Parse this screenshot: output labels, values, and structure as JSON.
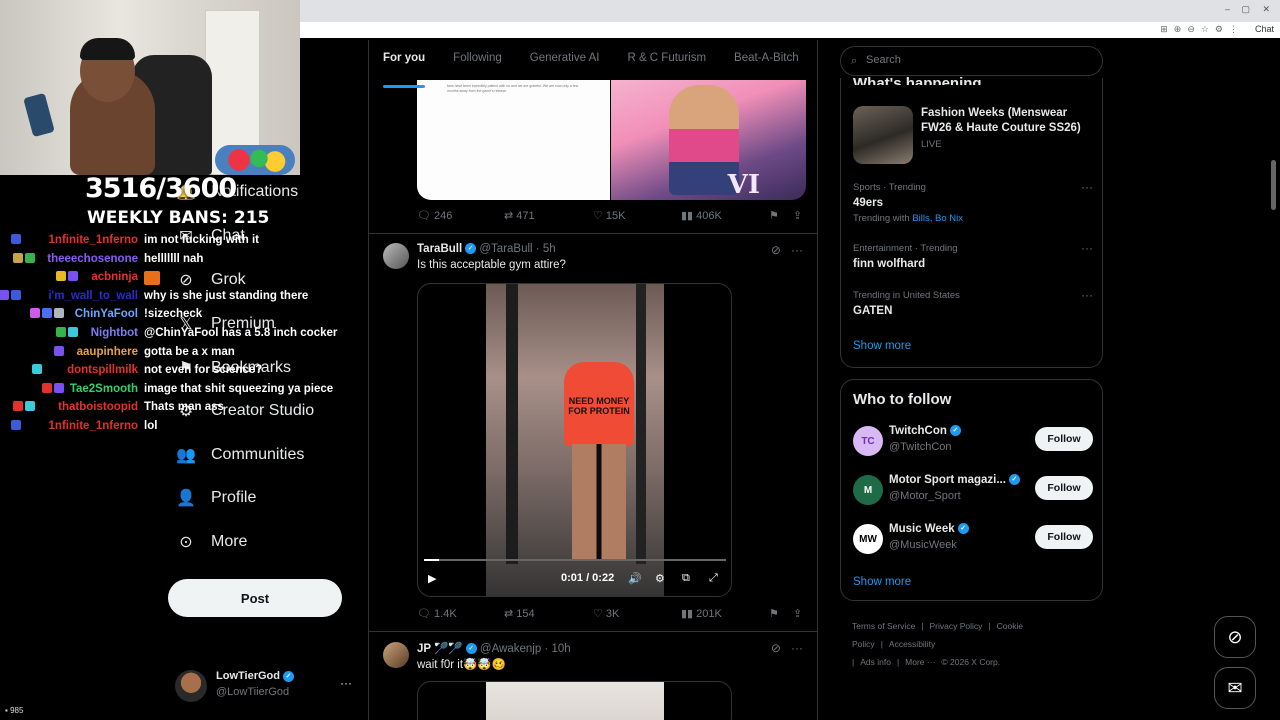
{
  "browser": {
    "chat_chip": "Chat",
    "window_controls": [
      "–",
      "▢",
      "✕"
    ]
  },
  "stream": {
    "counter": "3516/3600",
    "bans": "WEEKLY BANS: 215",
    "viewer_count": "985",
    "chat": [
      {
        "user": "1nfinite_1nferno",
        "color": "#e1322c",
        "msg": "im not fucking with it",
        "badges": [
          "#3b5bdb"
        ]
      },
      {
        "user": "theeechosenone",
        "color": "#8a5cf6",
        "msg": "helllllll nah",
        "badges": [
          "#c7a34a",
          "#37b24d"
        ]
      },
      {
        "user": "acbninja",
        "color": "#e1322c",
        "msg": "",
        "badges": [
          "#e8b923",
          "#7950f2"
        ],
        "emote": true
      },
      {
        "user": "i'm_wall_to_wall",
        "color": "#2b2bd0",
        "msg": "why is she just standing there",
        "badges": [
          "#37b24d",
          "#37b24d",
          "#7950f2",
          "#3b5bdb"
        ]
      },
      {
        "user": "ChinYaFool",
        "color": "#6aa7ff",
        "msg": "!sizecheck",
        "badges": [
          "#cc5de8",
          "#4c6ef5",
          "#adb5bd"
        ]
      },
      {
        "user": "Nightbot",
        "color": "#7c7cf2",
        "msg": "@ChinYaFool has a 5.8 inch cocker",
        "badges": [
          "#37b24d",
          "#3bc9db"
        ]
      },
      {
        "user": "aaupinhere",
        "color": "#e8a23a",
        "msg": "gotta be a x man",
        "badges": [
          "#7950f2"
        ]
      },
      {
        "user": "dontspillmilk",
        "color": "#e1322c",
        "msg": "not even for science?",
        "badges": [
          "#3bc9db"
        ]
      },
      {
        "user": "Tae2Smooth",
        "color": "#37d067",
        "msg": "image that shit squeezing ya piece",
        "badges": [
          "#e1322c",
          "#7950f2"
        ]
      },
      {
        "user": "thatboistoopid",
        "color": "#e1322c",
        "msg": "Thats man ass",
        "badges": [
          "#e1322c",
          "#3bc9db"
        ]
      },
      {
        "user": "1nfinite_1nferno",
        "color": "#e1322c",
        "msg": "lol",
        "badges": [
          "#3b5bdb"
        ]
      }
    ]
  },
  "nav": {
    "items": [
      {
        "label": "Notifications",
        "icon": "bell-icon"
      },
      {
        "label": "Chat",
        "icon": "chat-icon"
      },
      {
        "label": "Grok",
        "icon": "grok-icon"
      },
      {
        "label": "Premium",
        "icon": "x-logo-icon"
      },
      {
        "label": "Bookmarks",
        "icon": "bookmark-icon"
      },
      {
        "label": "Creator Studio",
        "icon": "creator-icon"
      },
      {
        "label": "Communities",
        "icon": "people-icon"
      },
      {
        "label": "Profile",
        "icon": "person-icon"
      },
      {
        "label": "More",
        "icon": "more-circle-icon"
      }
    ],
    "post_label": "Post",
    "account": {
      "name": "LowTierGod",
      "handle": "@LowTiierGod",
      "more": "···"
    }
  },
  "feed": {
    "tabs": [
      "For you",
      "Following",
      "Generative AI",
      "R & C Futurism",
      "Beat-A-Bitch"
    ],
    "tweet1": {
      "doc_text": "fans have been incredibly patient with us and we are grateful. We are now only a few months away from the game's release.",
      "art_text": "VI",
      "actions": {
        "replies": "246",
        "reposts": "471",
        "likes": "15K",
        "views": "406K"
      }
    },
    "tweet2": {
      "name": "TaraBull",
      "handle": "@TaraBull · 5h",
      "text": "Is this acceptable gym attire?",
      "shirt_text": "NEED MONEY FOR PROTEIN",
      "video_time": "0:01 / 0:22",
      "video_progress": 0.05,
      "actions": {
        "replies": "1.4K",
        "reposts": "154",
        "likes": "3K",
        "views": "201K"
      }
    },
    "tweet3": {
      "name": "JP 🏸🏸",
      "handle": "@Awakenjp · 10h",
      "text": "wait f0r it🤯🤯🥴"
    }
  },
  "sidebar": {
    "search_placeholder": "Search",
    "happening_title": "What's happening",
    "event": {
      "title": "Fashion Weeks (Menswear FW26 & Haute Couture SS26)",
      "status": "LIVE"
    },
    "trends": [
      {
        "category": "Sports · Trending",
        "name": "49ers",
        "with_prefix": "Trending with",
        "with": "Bills, Bo Nix"
      },
      {
        "category": "Entertainment · Trending",
        "name": "finn wolfhard"
      },
      {
        "category": "Trending in United States",
        "name": "GATEN"
      }
    ],
    "show_more": "Show more",
    "who_to_follow_title": "Who to follow",
    "follow_label": "Follow",
    "who_to_follow": [
      {
        "name": "TwitchCon",
        "handle": "@TwitchCon",
        "avatar_text": "TC",
        "avatar_bg": "#d9b9f4",
        "avatar_fg": "#6b2fc2"
      },
      {
        "name": "Motor Sport magazi...",
        "handle": "@Motor_Sport",
        "avatar_text": "M",
        "avatar_bg": "#1f6b47",
        "avatar_fg": "#fff"
      },
      {
        "name": "Music Week",
        "handle": "@MusicWeek",
        "avatar_text": "MW",
        "avatar_bg": "#fff",
        "avatar_fg": "#000"
      }
    ],
    "footer": [
      "Terms of Service",
      "|",
      "Privacy Policy",
      "|",
      "Cookie Policy",
      "|",
      "Accessibility",
      "|",
      "Ads info",
      "|",
      "More ···",
      "© 2026 X Corp."
    ]
  },
  "colors": {
    "accent": "#1d9bf0",
    "background": "#000000",
    "text": "#e7e9ea",
    "muted": "#71767b"
  }
}
